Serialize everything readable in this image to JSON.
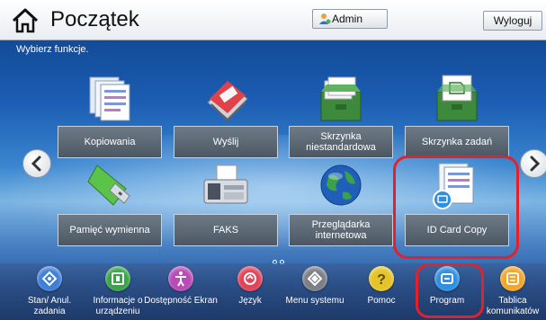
{
  "header": {
    "title": "Początek",
    "admin_label": "Admin",
    "logout_label": "Wyloguj"
  },
  "subtitle": "Wybierz funkcje.",
  "tiles": [
    {
      "label": "Kopiowania",
      "icon": "copy-documents-icon"
    },
    {
      "label": "Wyślij",
      "icon": "send-icon"
    },
    {
      "label": "Skrzynka niestandardowa",
      "icon": "custom-box-folder-icon"
    },
    {
      "label": "Skrzynka zadań",
      "icon": "job-box-folder-icon"
    },
    {
      "label": "Pamięć wymienna",
      "icon": "usb-drive-icon"
    },
    {
      "label": "FAKS",
      "icon": "fax-machine-icon"
    },
    {
      "label": "Przeglądarka internetowa",
      "icon": "globe-icon"
    },
    {
      "label": "ID Card Copy",
      "icon": "id-card-copy-icon"
    }
  ],
  "bottom_bar": [
    {
      "label": "Stan/ Anul. zadania",
      "icon": "status-icon",
      "color": "#3f7fd6"
    },
    {
      "label": "Informacje o urządzeniu",
      "icon": "device-info-icon",
      "color": "#3aa34a"
    },
    {
      "label": "Dostępność Ekran",
      "icon": "accessibility-icon",
      "color": "#b84bb8"
    },
    {
      "label": "Język",
      "icon": "language-icon",
      "color": "#e0445a"
    },
    {
      "label": "Menu systemu",
      "icon": "system-menu-icon",
      "color": "#7c7f87"
    },
    {
      "label": "Pomoc",
      "icon": "help-icon",
      "color": "#e5c42a"
    },
    {
      "label": "Program",
      "icon": "program-icon",
      "color": "#2f8fe0"
    },
    {
      "label": "Tablica komunikatów",
      "icon": "message-board-icon",
      "color": "#f2a628"
    }
  ],
  "colors": {
    "highlight": "#e4202a",
    "tile_label_bg": "#5a6572"
  }
}
